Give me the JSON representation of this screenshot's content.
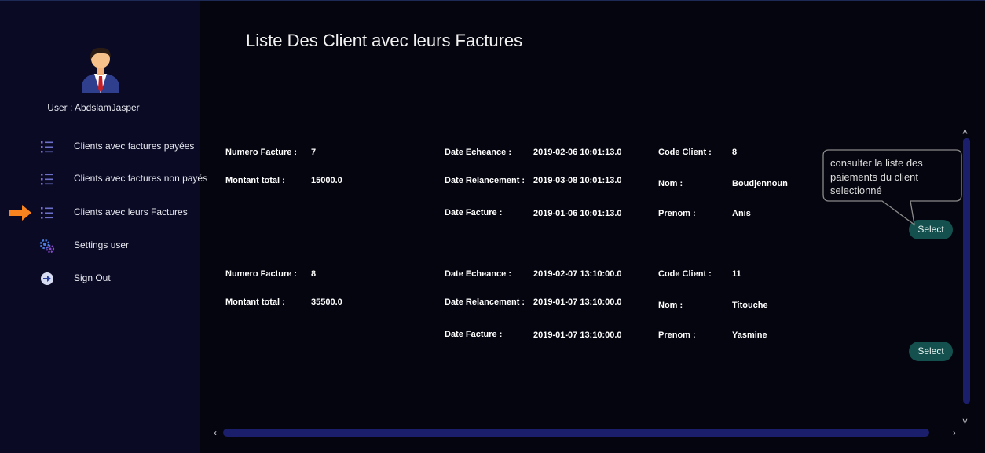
{
  "user": {
    "label": "User : AbdslamJasper"
  },
  "sidebar": {
    "items": [
      {
        "label": "Clients avec factures payées",
        "icon": "list-icon"
      },
      {
        "label": "Clients avec factures non payés",
        "icon": "list-icon"
      },
      {
        "label": "Clients avec leurs Factures",
        "icon": "list-icon",
        "active": true
      },
      {
        "label": "Settings user",
        "icon": "gears-icon"
      },
      {
        "label": "Sign Out",
        "icon": "sign-out-icon"
      }
    ]
  },
  "main": {
    "title": "Liste Des Client avec leurs Factures",
    "labels": {
      "numero_facture": "Numero Facture :",
      "montant_total": "Montant total :",
      "date_echeance": "Date Echeance :",
      "date_relancement": "Date Relancement :",
      "date_facture": "Date Facture :",
      "code_client": "Code Client :",
      "nom": "Nom :",
      "prenom": "Prenom :"
    },
    "select_label": "Select",
    "tooltip": "consulter la liste des paiements du client selectionné",
    "factures": [
      {
        "numero": "7",
        "montant": "15000.0",
        "date_echeance": "2019-02-06 10:01:13.0",
        "date_relancement": "2019-03-08 10:01:13.0",
        "date_facture": "2019-01-06 10:01:13.0",
        "code_client": "8",
        "nom": "Boudjennoun",
        "prenom": "Anis"
      },
      {
        "numero": "8",
        "montant": "35500.0",
        "date_echeance": "2019-02-07 13:10:00.0",
        "date_relancement": "2019-01-07 13:10:00.0",
        "date_facture": "2019-01-07 13:10:00.0",
        "code_client": "11",
        "nom": "Titouche",
        "prenom": "Yasmine"
      }
    ]
  },
  "colors": {
    "background": "#05050f",
    "sidebar": "#0a0a25",
    "accent_arrow": "#f7841e",
    "select_button": "#14504e",
    "scrollbar": "#1b1e6b"
  }
}
